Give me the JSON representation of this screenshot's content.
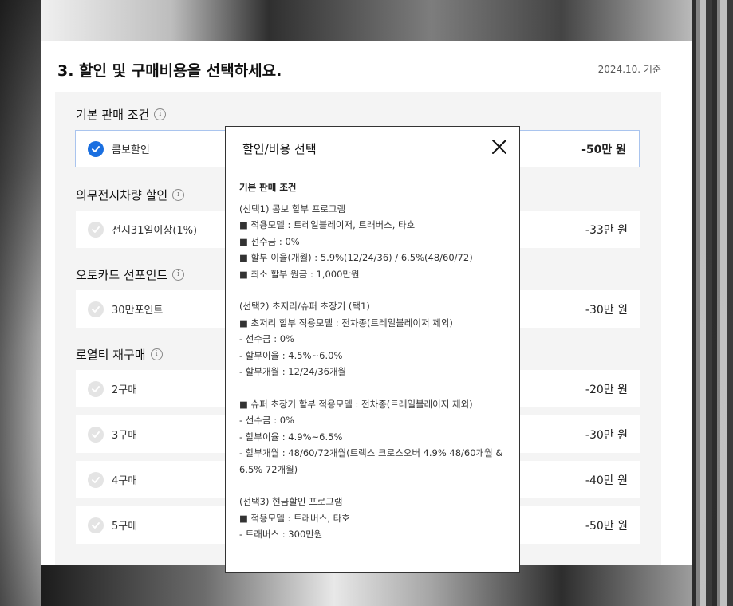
{
  "header": {
    "title": "3. 할인 및 구매비용을 선택하세요.",
    "basis": "2024.10. 기준"
  },
  "icons": {
    "info": "i"
  },
  "groups": [
    {
      "label": "기본 판매 조건",
      "items": [
        {
          "label": "콤보할인",
          "amount": "-50만 원",
          "selected": true
        }
      ]
    },
    {
      "label": "의무전시차량 할인",
      "items": [
        {
          "label": "전시31일이상(1%)",
          "amount": "-33만 원",
          "selected": false
        }
      ]
    },
    {
      "label": "오토카드 선포인트",
      "items": [
        {
          "label": "30만포인트",
          "amount": "-30만 원",
          "selected": false
        }
      ]
    },
    {
      "label": "로열티 재구매",
      "items": [
        {
          "label": "2구매",
          "amount": "-20만 원",
          "selected": false
        },
        {
          "label": "3구매",
          "amount": "-30만 원",
          "selected": false
        },
        {
          "label": "4구매",
          "amount": "-40만 원",
          "selected": false
        },
        {
          "label": "5구매",
          "amount": "-50만 원",
          "selected": false
        }
      ]
    }
  ],
  "modal": {
    "title": "할인/비용 선택",
    "close_icon": "close-icon",
    "section": "기본 판매 조건",
    "lines": [
      "(선택1) 콤보 할부 프로그램",
      "■ 적용모델 : 트레일블레이저, 트래버스, 타호",
      "■ 선수금 : 0%",
      "■ 할부 이율(개월) : 5.9%(12/24/36) / 6.5%(48/60/72)",
      "■ 최소 할부 원금 : 1,000만원",
      "",
      "(선택2) 초저리/슈퍼 초장기 (택1)",
      "■ 초저리 할부 적용모델 : 전차종(트레일블레이저 제외)",
      "- 선수금 : 0%",
      "- 할부이율 : 4.5%~6.0%",
      "- 할부개월 : 12/24/36개월",
      "",
      "■ 슈퍼 초장기 할부 적용모델 : 전차종(트레일블레이저 제외)",
      "- 선수금 : 0%",
      "- 할부이율 : 4.9%~6.5%",
      "- 할부개월 : 48/60/72개월(트랙스 크로스오버 4.9% 48/60개월 & 6.5% 72개월)",
      "",
      "(선택3) 현금할인 프로그램",
      "■ 적용모델 : 트래버스, 타호",
      "- 트래버스 : 300만원"
    ]
  }
}
